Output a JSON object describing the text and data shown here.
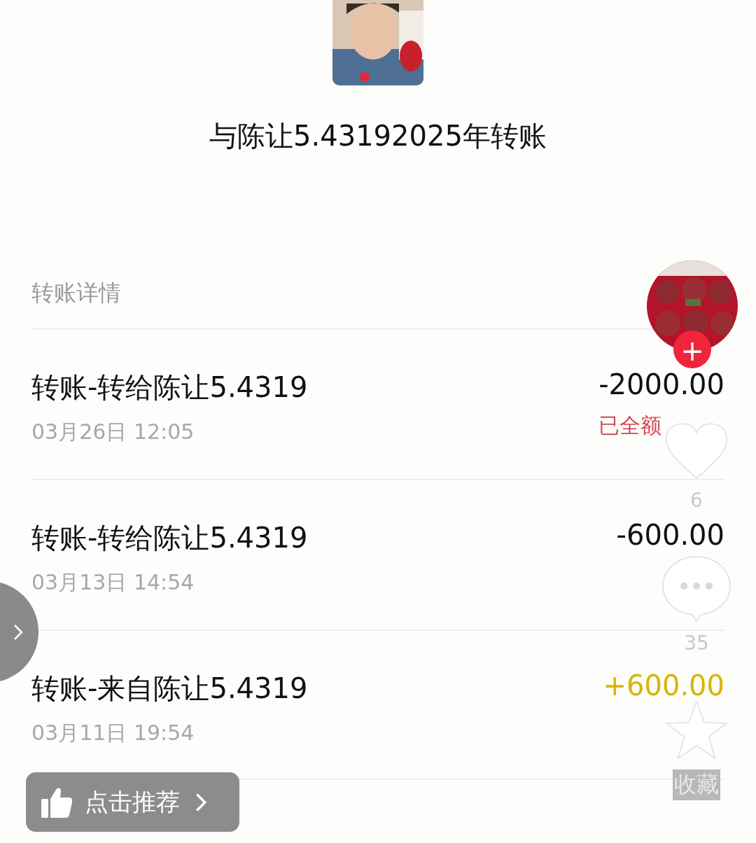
{
  "title": "与陈让5.43192025年转账",
  "section_label": "转账详情",
  "transactions": [
    {
      "title": "转账-转给陈让5.4319",
      "date": "03月26日 12:05",
      "amount": "-2000.00",
      "kind": "outgoing",
      "status": "已全额"
    },
    {
      "title": "转账-转给陈让5.4319",
      "date": "03月13日 14:54",
      "amount": "-600.00",
      "kind": "outgoing"
    },
    {
      "title": "转账-来自陈让5.4319",
      "date": "03月11日 19:54",
      "amount": "+600.00",
      "kind": "incoming"
    }
  ],
  "side_actions": {
    "follow_button": "+",
    "like_count": "6",
    "comment_count": "35",
    "favorite_label": "收藏"
  },
  "recommend_button": {
    "label": "点击推荐"
  }
}
